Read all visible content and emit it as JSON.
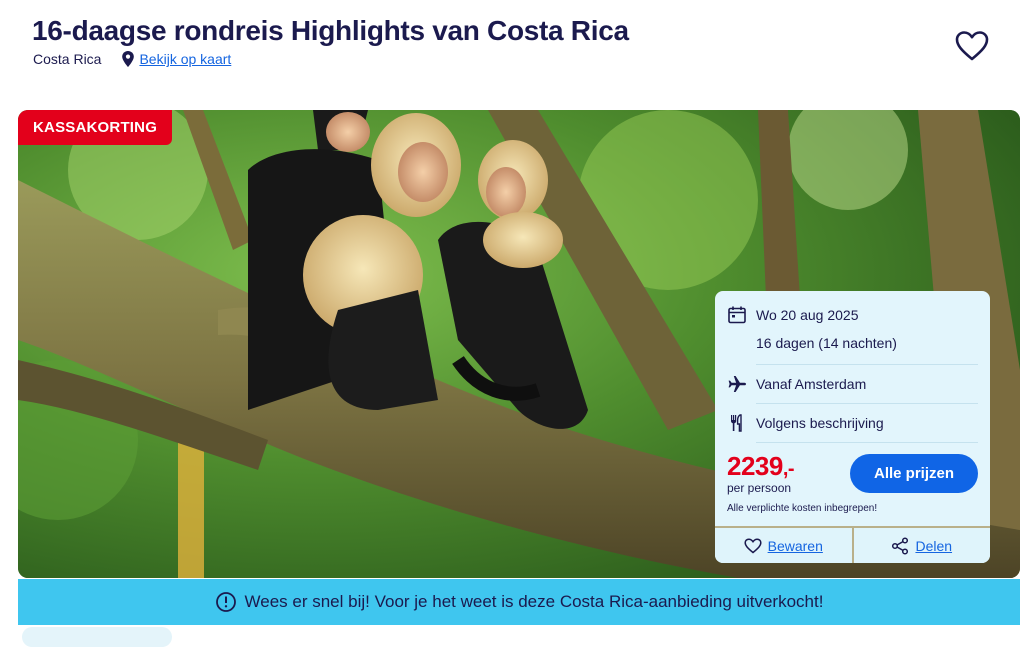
{
  "header": {
    "title": "16-daagse rondreis Highlights van Costa Rica",
    "country": "Costa Rica",
    "map_link": "Bekijk op kaart"
  },
  "hero": {
    "badge": "KASSAKORTING",
    "image_icon": "capuchin-monkeys-photo"
  },
  "card": {
    "date": "Wo 20 aug 2025",
    "duration": "16 dagen (14 nachten)",
    "departure": "Vanaf Amsterdam",
    "meals": "Volgens beschrijving",
    "price": "2239",
    "price_suffix": ",-",
    "per_person": "per persoon",
    "costs_note": "Alle verplichte kosten inbegrepen!",
    "prices_button": "Alle prijzen",
    "save_label": "Bewaren",
    "share_label": "Delen"
  },
  "banner": {
    "text": "Wees er snel bij! Voor je het weet is deze Costa Rica-aanbieding uitverkocht!"
  },
  "colors": {
    "navy": "#1b1a4e",
    "red": "#e3001b",
    "blue": "#1065e6",
    "banner": "#3fc6ef",
    "card": "#e2f5fc"
  }
}
